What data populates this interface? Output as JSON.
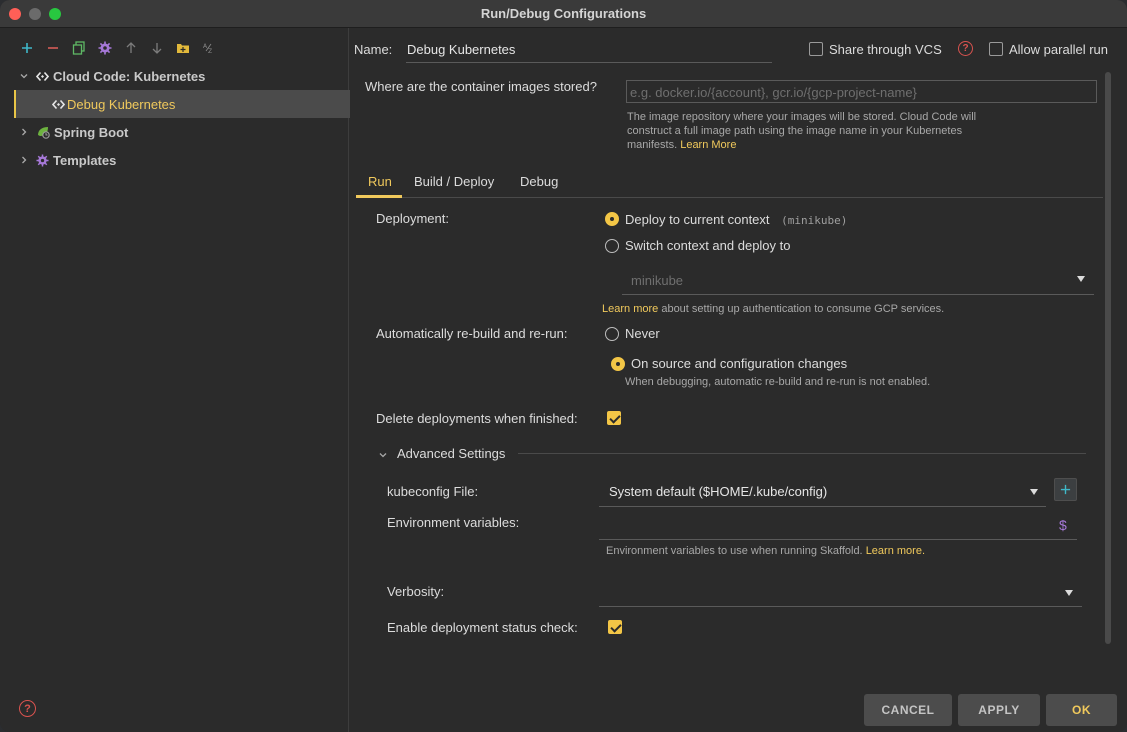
{
  "window": {
    "title": "Run/Debug Configurations"
  },
  "toolbar": {
    "icons": [
      "add-icon",
      "remove-icon",
      "copy-icon",
      "settings-icon",
      "move-up-icon",
      "move-down-icon",
      "new-folder-icon",
      "sort-icon"
    ]
  },
  "tree": {
    "cloud_code": "Cloud Code: Kubernetes",
    "debug_kubernetes": "Debug Kubernetes",
    "spring_boot": "Spring Boot",
    "templates": "Templates"
  },
  "header": {
    "name_label": "Name:",
    "name_value": "Debug Kubernetes",
    "share_label": "Share through VCS",
    "parallel_label": "Allow parallel run"
  },
  "images": {
    "question": "Where are the container images stored?",
    "placeholder": "e.g. docker.io/{account}, gcr.io/{gcp-project-name}",
    "help_line1": "The image repository where your images will be stored. Cloud Code will",
    "help_line2": "construct a full image path using the image name in your Kubernetes",
    "help_line3": "manifests.",
    "learn_more": "Learn More"
  },
  "tabs": [
    "Run",
    "Build / Deploy",
    "Debug"
  ],
  "run": {
    "deployment_label": "Deployment:",
    "deploy_current": "Deploy to current context",
    "current_context": "(minikube)",
    "switch_context": "Switch context and deploy to",
    "context_select": "minikube",
    "auth_learn_more": "Learn more",
    "auth_text": "about setting up authentication to consume GCP services.",
    "rebuild_label": "Automatically re-build and re-run:",
    "never": "Never",
    "on_source": "On source and configuration changes",
    "debug_note": "When debugging, automatic re-build and re-run is not enabled.",
    "delete_label": "Delete deployments when finished:",
    "advanced_label": "Advanced Settings",
    "kubeconfig_label": "kubeconfig File:",
    "kubeconfig_value": "System default ($HOME/.kube/config)",
    "env_label": "Environment variables:",
    "env_help": "Environment variables to use when running Skaffold.",
    "env_learn_more": "Learn more.",
    "verbosity_label": "Verbosity:",
    "status_check_label": "Enable deployment status check:"
  },
  "footer": {
    "cancel": "CANCEL",
    "apply": "APPLY",
    "ok": "OK"
  },
  "colors": {
    "accent": "#f0c95c",
    "background": "#2b2b2b"
  }
}
